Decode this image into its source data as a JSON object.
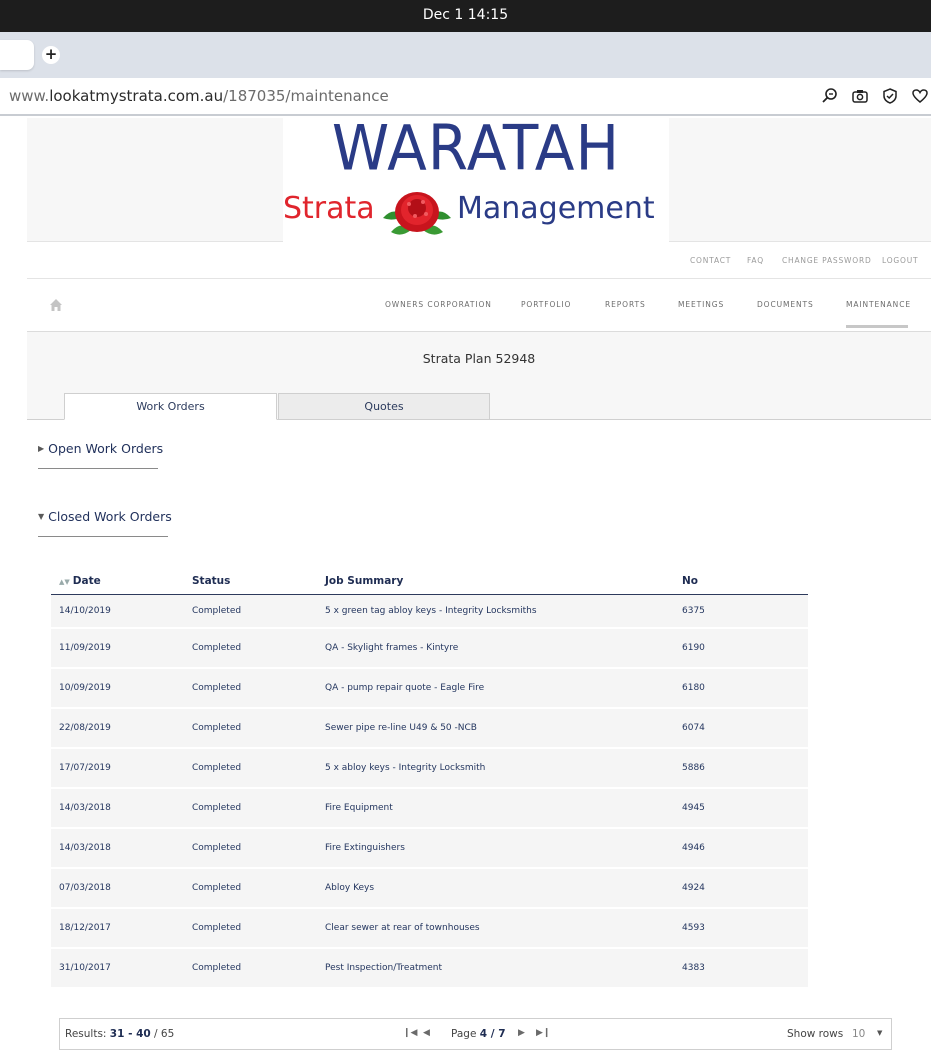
{
  "os": {
    "clock": "Dec 1  14:15"
  },
  "browser": {
    "url_prefix": "www.",
    "url_domain": "lookatmystrata.com.au",
    "url_path": "/187035/maintenance",
    "new_tab_label": "+"
  },
  "logo": {
    "big": "WARATAH",
    "left": "Strata",
    "right": "Management"
  },
  "top_links": [
    "CONTACT",
    "FAQ",
    "CHANGE PASSWORD",
    "LOGOUT"
  ],
  "nav": {
    "items": [
      "OWNERS CORPORATION",
      "PORTFOLIO",
      "REPORTS",
      "MEETINGS",
      "DOCUMENTS",
      "MAINTENANCE"
    ],
    "active": "MAINTENANCE"
  },
  "plan_title": "Strata Plan 52948",
  "tabs": [
    {
      "label": "Work Orders",
      "active": true
    },
    {
      "label": "Quotes",
      "active": false
    }
  ],
  "sections": {
    "open": "Open Work Orders",
    "closed": "Closed Work Orders"
  },
  "table": {
    "headers": [
      "Date",
      "Status",
      "Job Summary",
      "No"
    ],
    "rows": [
      [
        "14/10/2019",
        "Completed",
        "5 x green tag abloy keys - Integrity Locksmiths",
        "6375"
      ],
      [
        "11/09/2019",
        "Completed",
        "QA - Skylight frames - Kintyre",
        "6190"
      ],
      [
        "10/09/2019",
        "Completed",
        "QA - pump repair quote - Eagle Fire",
        "6180"
      ],
      [
        "22/08/2019",
        "Completed",
        "Sewer pipe re-line U49 & 50 -NCB",
        "6074"
      ],
      [
        "17/07/2019",
        "Completed",
        "5 x abloy keys - Integrity Locksmith",
        "5886"
      ],
      [
        "14/03/2018",
        "Completed",
        "Fire Equipment",
        "4945"
      ],
      [
        "14/03/2018",
        "Completed",
        "Fire Extinguishers",
        "4946"
      ],
      [
        "07/03/2018",
        "Completed",
        "Abloy Keys",
        "4924"
      ],
      [
        "18/12/2017",
        "Completed",
        "Clear sewer at rear of townhouses",
        "4593"
      ],
      [
        "31/10/2017",
        "Completed",
        "Pest Inspection/Treatment",
        "4383"
      ]
    ]
  },
  "pager": {
    "results_label": "Results: ",
    "results_range": "31 - 40",
    "results_total": " / 65",
    "page_label": "Page ",
    "page_value": "4 / 7",
    "show_rows_label": "Show rows",
    "rows_value": "10"
  },
  "colors": {
    "brand_blue": "#2a3b86",
    "brand_red": "#e0252d",
    "text_navy": "#1e2c52"
  }
}
